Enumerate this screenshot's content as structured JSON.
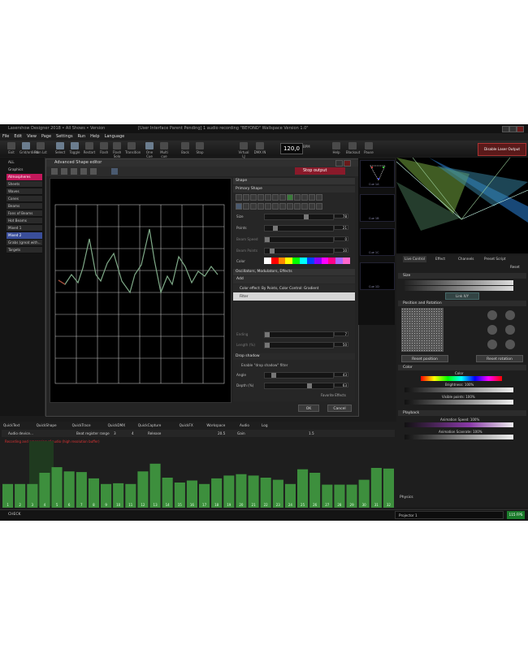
{
  "app": {
    "title": "Lasershow Designer 2018  •  All Shows •  Version",
    "title_mid": "[User Interface Parent Pending]   1 audio recording   \"BEYOND\" Wallspace Version 1.0\""
  },
  "menu": [
    "File",
    "Edit",
    "View",
    "Page",
    "Settings",
    "Run",
    "Help",
    "Language"
  ],
  "toolbar": [
    {
      "label": "Exit",
      "on": false
    },
    {
      "label": "Grid/ordinal",
      "on": true
    },
    {
      "label": "Plan Lst",
      "on": false
    },
    {
      "label": "Select",
      "on": true
    },
    {
      "label": "Toggle",
      "on": true
    },
    {
      "label": "Restart",
      "on": false
    },
    {
      "label": "Flash",
      "on": false
    },
    {
      "label": "Flash Solo",
      "on": false
    },
    {
      "label": "Transition",
      "on": false
    },
    {
      "label": "One Cue",
      "on": true
    },
    {
      "label": "Multi cue",
      "on": false
    },
    {
      "label": "Back",
      "on": false
    },
    {
      "label": "Stop",
      "on": false
    },
    {
      "label": "Virtual LJ",
      "on": false
    },
    {
      "label": "DMX IN",
      "on": false
    },
    {
      "label": "Help",
      "on": false
    },
    {
      "label": "Blackout",
      "on": false
    },
    {
      "label": "Pause",
      "on": false
    }
  ],
  "bpm": "120,0",
  "bpm_label": "BPM",
  "disable_output": "Disable Laser Output",
  "left_panel": [
    {
      "label": "ALL",
      "style": "plain"
    },
    {
      "label": "Graphics",
      "style": "plain"
    },
    {
      "label": "Atmospheres",
      "style": "sel"
    },
    {
      "label": "Sheets",
      "style": "item"
    },
    {
      "label": "Waves",
      "style": "item"
    },
    {
      "label": "Cones",
      "style": "item"
    },
    {
      "label": "Beams",
      "style": "item"
    },
    {
      "label": "Fans of Beams",
      "style": "item"
    },
    {
      "label": "Hot Beams",
      "style": "item"
    },
    {
      "label": "Mixed 1",
      "style": "item"
    },
    {
      "label": "Mixed 2",
      "style": "blue"
    },
    {
      "label": "Grabs (great with...",
      "style": "item"
    },
    {
      "label": "Targets",
      "style": "item"
    }
  ],
  "editor": {
    "title": "Advanced Shape editor",
    "stop_output": "Stop output",
    "shape_header": "Shape",
    "primary_shape": "Primary Shape",
    "params": [
      {
        "label": "Size",
        "value": "78"
      },
      {
        "label": "Points",
        "value": "21"
      },
      {
        "label": "Beam Speed",
        "value": "0"
      },
      {
        "label": "Beam Points",
        "value": "10"
      }
    ],
    "color_label": "Color",
    "osc_header": "Oscillators, Modulators, Effects",
    "add_label": "Add",
    "effects": [
      "Color effect: By Points, Color Control: Gradient",
      "Filter"
    ],
    "lower_params": [
      {
        "label": "Ending",
        "value": "7"
      },
      {
        "label": "Length (%)",
        "value": "50"
      }
    ],
    "drop_shadow": "Drop shadow",
    "enable_shadow": "Enable \"drop shadow\" filter",
    "angle": {
      "label": "Angle",
      "value": "43"
    },
    "depth": {
      "label": "Depth (%)",
      "value": "63"
    },
    "favorite": "Favorite Effects",
    "ok": "OK",
    "cancel": "Cancel"
  },
  "cues": [
    "Cue 1A",
    "Cue 1B",
    "Cue 1C",
    "Cue 1D"
  ],
  "right_tabs": [
    "Live Control",
    "Effect",
    "Channels",
    "Preset Script"
  ],
  "right_reset": "Reset",
  "size_section": "Size",
  "link_label": "Link X/Y",
  "position_section": "Position and Rotation",
  "reset_position": "Reset position",
  "reset_rotation": "Reset rotation",
  "color_section": "Color",
  "color_sub": "Color",
  "brightness": "Brightness: 100%",
  "visible_points": "Visible points: 100%",
  "playback_section": "Playback",
  "anim_speed": "Animation Speed: 100%",
  "anim_scanrate": "Animation Scanrate: 100%",
  "physics": "Physics",
  "projector": "Projector 1",
  "fps": "115 FPS",
  "bottom_tabs": [
    "QuickText",
    "QuickShape",
    "QuickTrace",
    "QuickDMX",
    "QuickCapture",
    "QuickFX",
    "Workspace",
    "Audio",
    "Log"
  ],
  "audio": {
    "device": "Audio device...",
    "band_label": "Beat register range",
    "band_from": "3",
    "band_to": "4",
    "release": "Release",
    "release_val": "20.5",
    "gain": "Gain",
    "gain_val": "1.5",
    "warning": "Recording and processing of audio (high resolution buffer)"
  },
  "bars": {
    "values": [
      0.34,
      0.34,
      0.34,
      0.5,
      0.58,
      0.52,
      0.51,
      0.42,
      0.34,
      0.35,
      0.34,
      0.52,
      0.63,
      0.43,
      0.36,
      0.39,
      0.34,
      0.42,
      0.46,
      0.48,
      0.46,
      0.43,
      0.4,
      0.34,
      0.55,
      0.5,
      0.33,
      0.33,
      0.33,
      0.4,
      0.57,
      0.56
    ],
    "labels": [
      "1",
      "2",
      "3",
      "4",
      "5",
      "6",
      "7",
      "8",
      "9",
      "10",
      "11",
      "12",
      "13",
      "14",
      "15",
      "16",
      "17",
      "18",
      "19",
      "20",
      "21",
      "22",
      "23",
      "24",
      "25",
      "26",
      "27",
      "28",
      "29",
      "30",
      "31",
      "32"
    ],
    "color": "#3d8f3d"
  },
  "status": {
    "check": "CHECK"
  }
}
